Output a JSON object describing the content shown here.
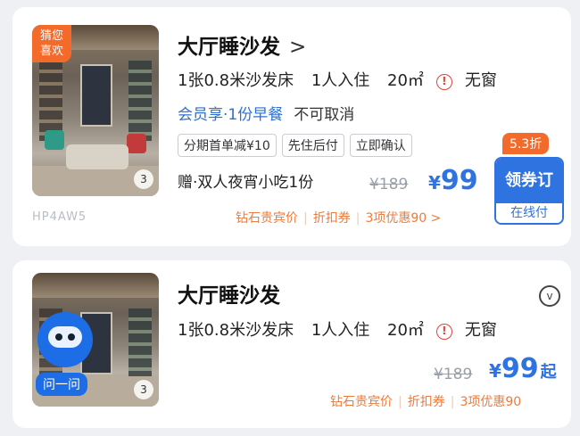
{
  "card1": {
    "badge": [
      "猜您",
      "喜欢"
    ],
    "photo_count": "3",
    "watermark": "HP4AW5",
    "title": "大厅睡沙发",
    "title_chevron": ">",
    "bed": "1张0.8米沙发床",
    "occupancy": "1人入住",
    "area": "20㎡",
    "window": "无窗",
    "perks": "会员享·1份早餐",
    "cancel": "不可取消",
    "tags": [
      "分期首单减¥10",
      "先住后付",
      "立即确认"
    ],
    "gift": "赠·双人夜宵小吃1份",
    "original_price": "¥189",
    "price_symbol": "¥",
    "price": "99",
    "discount_badge": "5.3折",
    "book_button": "领券订",
    "book_sub": "在线付",
    "promos": [
      "钻石贵宾价",
      "折扣券",
      "3项优惠90 >"
    ]
  },
  "card2": {
    "ask_button": "问一问",
    "photo_count": "3",
    "title": "大厅睡沙发",
    "bed": "1张0.8米沙发床",
    "occupancy": "1人入住",
    "area": "20㎡",
    "window": "无窗",
    "original_price": "¥189",
    "price_symbol": "¥",
    "price": "99",
    "price_suffix": "起",
    "promos": [
      "钻石贵宾价",
      "折扣券",
      "3项优惠90"
    ]
  },
  "icons": {
    "warn": "!",
    "expand": "v"
  },
  "colors": {
    "accent_blue": "#2f73e0",
    "orange": "#f46a2a",
    "warn_red": "#e1443a"
  }
}
